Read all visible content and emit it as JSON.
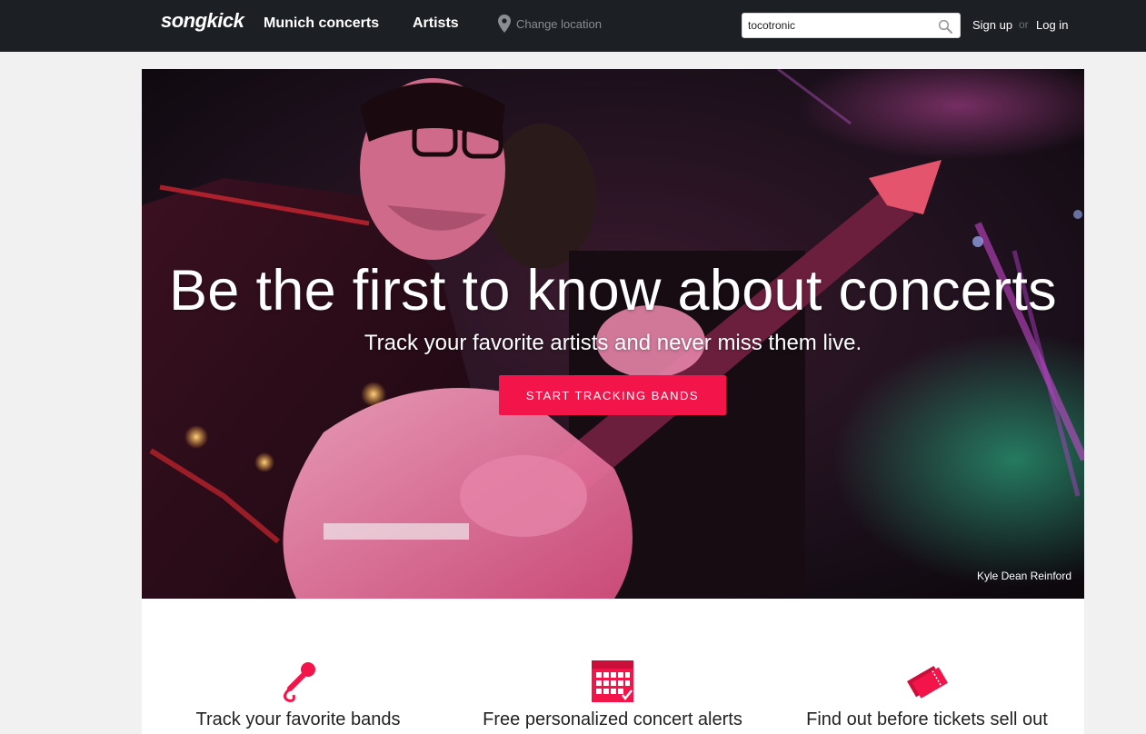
{
  "header": {
    "logo": "songkick",
    "nav": {
      "munich": "Munich concerts",
      "artists": "Artists"
    },
    "location": {
      "icon": "location-pin-icon",
      "label": "Change location"
    },
    "search": {
      "value": "tocotronic",
      "icon": "search-icon"
    },
    "auth": {
      "signup": "Sign up",
      "or": "or",
      "login": "Log in"
    }
  },
  "hero": {
    "title": "Be the first to know about concerts",
    "subtitle": "Track your favorite artists and never miss them live.",
    "cta": "START TRACKING BANDS",
    "credit": "Kyle Dean Reinford"
  },
  "features": [
    {
      "icon": "microphone-icon",
      "label": "Track your favorite bands"
    },
    {
      "icon": "calendar-icon",
      "label": "Free personalized concert alerts"
    },
    {
      "icon": "tickets-icon",
      "label": "Find out before tickets sell out"
    }
  ],
  "colors": {
    "header_bg": "#1c1f23",
    "accent": "#f3144a",
    "page_bg": "#f1f1f1"
  }
}
